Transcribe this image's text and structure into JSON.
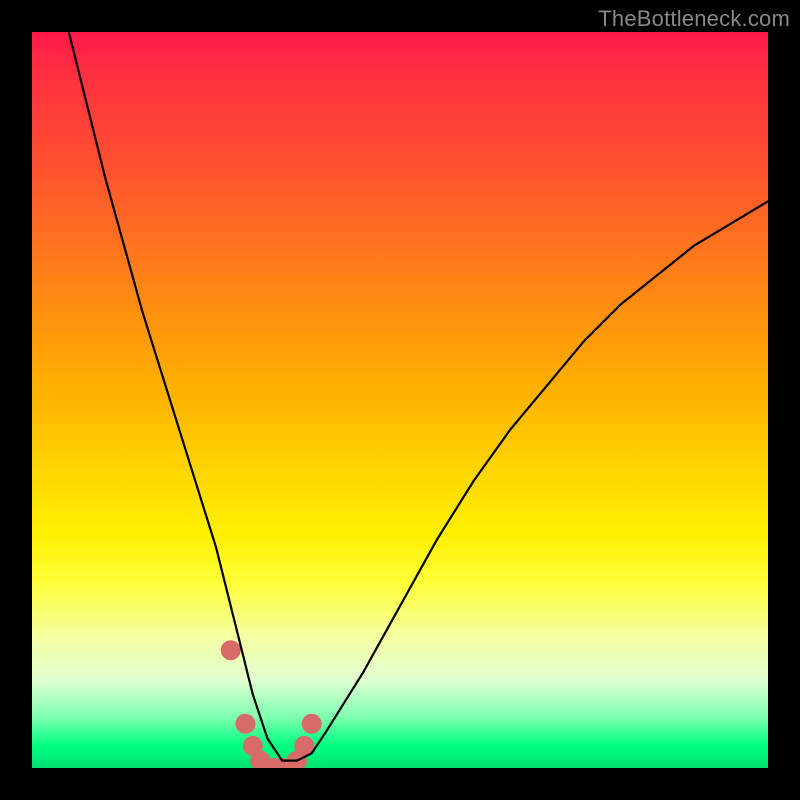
{
  "watermark": "TheBottleneck.com",
  "chart_data": {
    "type": "line",
    "title": "",
    "xlabel": "",
    "ylabel": "",
    "xlim": [
      0,
      100
    ],
    "ylim": [
      0,
      100
    ],
    "series": [
      {
        "name": "bottleneck-curve",
        "x": [
          5,
          10,
          15,
          20,
          25,
          28,
          30,
          32,
          34,
          36,
          38,
          40,
          45,
          50,
          55,
          60,
          65,
          70,
          75,
          80,
          85,
          90,
          95,
          100
        ],
        "values": [
          100,
          80,
          62,
          46,
          30,
          18,
          10,
          4,
          1,
          1,
          2,
          5,
          13,
          22,
          31,
          39,
          46,
          52,
          58,
          63,
          67,
          71,
          74,
          77
        ]
      },
      {
        "name": "marker-dots",
        "x": [
          27,
          29,
          30,
          31,
          32,
          33,
          34,
          35,
          36,
          37,
          38
        ],
        "values": [
          16,
          6,
          3,
          1,
          0,
          0,
          0,
          0,
          1,
          3,
          6
        ]
      }
    ],
    "legend": null,
    "grid": false
  },
  "colors": {
    "curve": "#000000",
    "markers": "#d86a6a",
    "background_top": "#ff1a4a",
    "background_bottom": "#00e070"
  }
}
